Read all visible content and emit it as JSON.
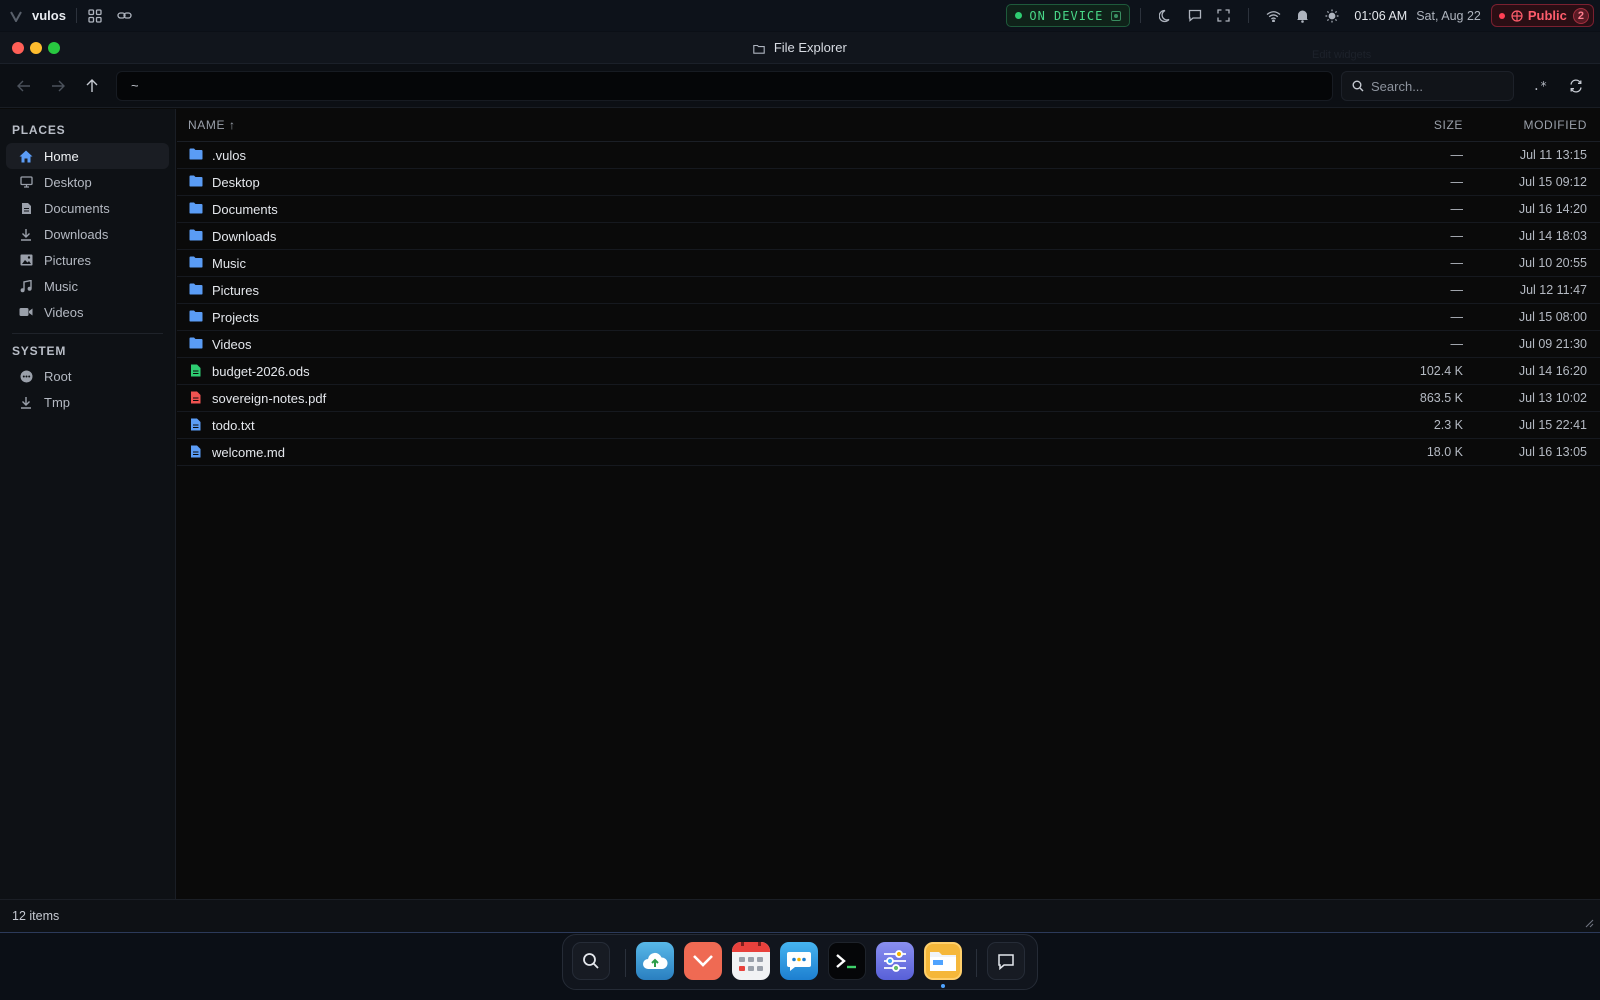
{
  "topbar": {
    "brand": "vulos",
    "device_status": "ON DEVICE",
    "time": "01:06 AM",
    "date": "Sat, Aug 22",
    "network": "Public",
    "network_count": "2"
  },
  "window": {
    "title": "File Explorer",
    "ghost_text": "Edit widgets"
  },
  "toolbar": {
    "path": "~",
    "search_placeholder": "Search...",
    "regex_label": ".*"
  },
  "sidebar": {
    "places_title": "PLACES",
    "places": [
      {
        "label": "Home",
        "icon": "home-icon",
        "active": true
      },
      {
        "label": "Desktop",
        "icon": "desktop-icon"
      },
      {
        "label": "Documents",
        "icon": "document-icon"
      },
      {
        "label": "Downloads",
        "icon": "download-icon"
      },
      {
        "label": "Pictures",
        "icon": "image-icon"
      },
      {
        "label": "Music",
        "icon": "music-icon"
      },
      {
        "label": "Videos",
        "icon": "video-icon"
      }
    ],
    "system_title": "SYSTEM",
    "system": [
      {
        "label": "Root",
        "icon": "root-icon"
      },
      {
        "label": "Tmp",
        "icon": "download-icon"
      }
    ]
  },
  "list": {
    "columns": {
      "name": "NAME ↑",
      "size": "SIZE",
      "modified": "MODIFIED"
    },
    "rows": [
      {
        "name": ".vulos",
        "type": "folder",
        "size": "—",
        "modified": "Jul 11 13:15"
      },
      {
        "name": "Desktop",
        "type": "folder",
        "size": "—",
        "modified": "Jul 15 09:12"
      },
      {
        "name": "Documents",
        "type": "folder",
        "size": "—",
        "modified": "Jul 16 14:20"
      },
      {
        "name": "Downloads",
        "type": "folder",
        "size": "—",
        "modified": "Jul 14 18:03"
      },
      {
        "name": "Music",
        "type": "folder",
        "size": "—",
        "modified": "Jul 10 20:55"
      },
      {
        "name": "Pictures",
        "type": "folder",
        "size": "—",
        "modified": "Jul 12 11:47"
      },
      {
        "name": "Projects",
        "type": "folder",
        "size": "—",
        "modified": "Jul 15 08:00"
      },
      {
        "name": "Videos",
        "type": "folder",
        "size": "—",
        "modified": "Jul 09 21:30"
      },
      {
        "name": "budget-2026.ods",
        "type": "spreadsheet",
        "size": "102.4 K",
        "modified": "Jul 14 16:20"
      },
      {
        "name": "sovereign-notes.pdf",
        "type": "pdf",
        "size": "863.5 K",
        "modified": "Jul 13 10:02"
      },
      {
        "name": "todo.txt",
        "type": "text",
        "size": "2.3 K",
        "modified": "Jul 15 22:41"
      },
      {
        "name": "welcome.md",
        "type": "text",
        "size": "18.0 K",
        "modified": "Jul 16 13:05"
      }
    ]
  },
  "status": {
    "item_count": "12 items"
  },
  "colors": {
    "folder": "#5b9cf5",
    "spreadsheet": "#2ecc71",
    "pdf": "#ef5350",
    "text": "#5b9cf5",
    "accent": "#4fa3ff"
  },
  "dock": {
    "items": [
      "search-icon",
      "cloud-upload-icon",
      "mail-icon",
      "calendar-icon",
      "chat-icon",
      "terminal-icon",
      "settings-icon",
      "files-icon",
      "messages-icon"
    ],
    "active": "files-icon"
  }
}
